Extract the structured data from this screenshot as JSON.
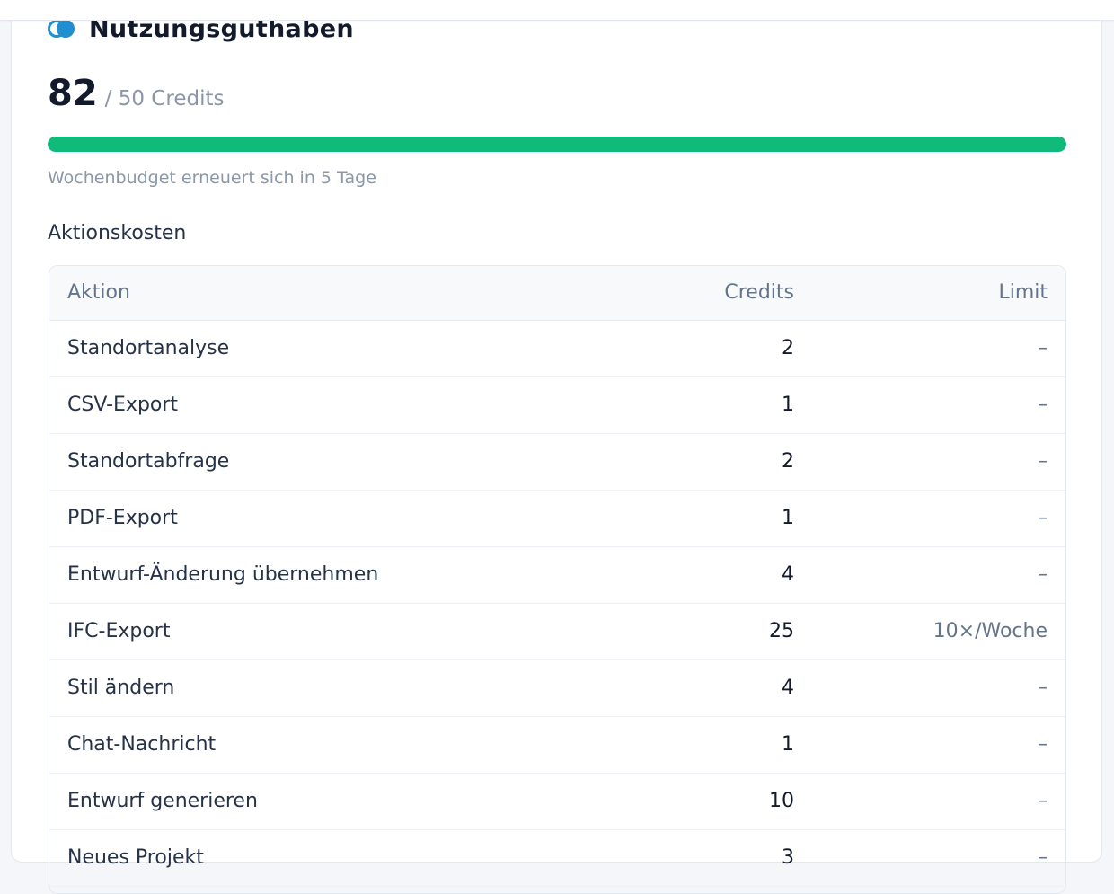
{
  "card": {
    "title": "Nutzungsguthaben",
    "icon": "credits-logo-icon",
    "accent_color": "#1f8fd1"
  },
  "balance": {
    "value": "82",
    "total_label": "/ 50 Credits",
    "progress_fraction": 1.0,
    "progress_color": "#0fba7b"
  },
  "renewal_text": "Wochenbudget erneuert sich in 5 Tage",
  "costs": {
    "section_title": "Aktionskosten",
    "columns": {
      "action": "Aktion",
      "credits": "Credits",
      "limit": "Limit"
    },
    "rows": [
      {
        "action": "Standortanalyse",
        "credits": "2",
        "limit": "–"
      },
      {
        "action": "CSV-Export",
        "credits": "1",
        "limit": "–"
      },
      {
        "action": "Standortabfrage",
        "credits": "2",
        "limit": "–"
      },
      {
        "action": "PDF-Export",
        "credits": "1",
        "limit": "–"
      },
      {
        "action": "Entwurf-Änderung übernehmen",
        "credits": "4",
        "limit": "–"
      },
      {
        "action": "IFC-Export",
        "credits": "25",
        "limit": "10×/Woche"
      },
      {
        "action": "Stil ändern",
        "credits": "4",
        "limit": "–"
      },
      {
        "action": "Chat-Nachricht",
        "credits": "1",
        "limit": "–"
      },
      {
        "action": "Entwurf generieren",
        "credits": "10",
        "limit": "–"
      },
      {
        "action": "Neues Projekt",
        "credits": "3",
        "limit": "–"
      }
    ]
  }
}
